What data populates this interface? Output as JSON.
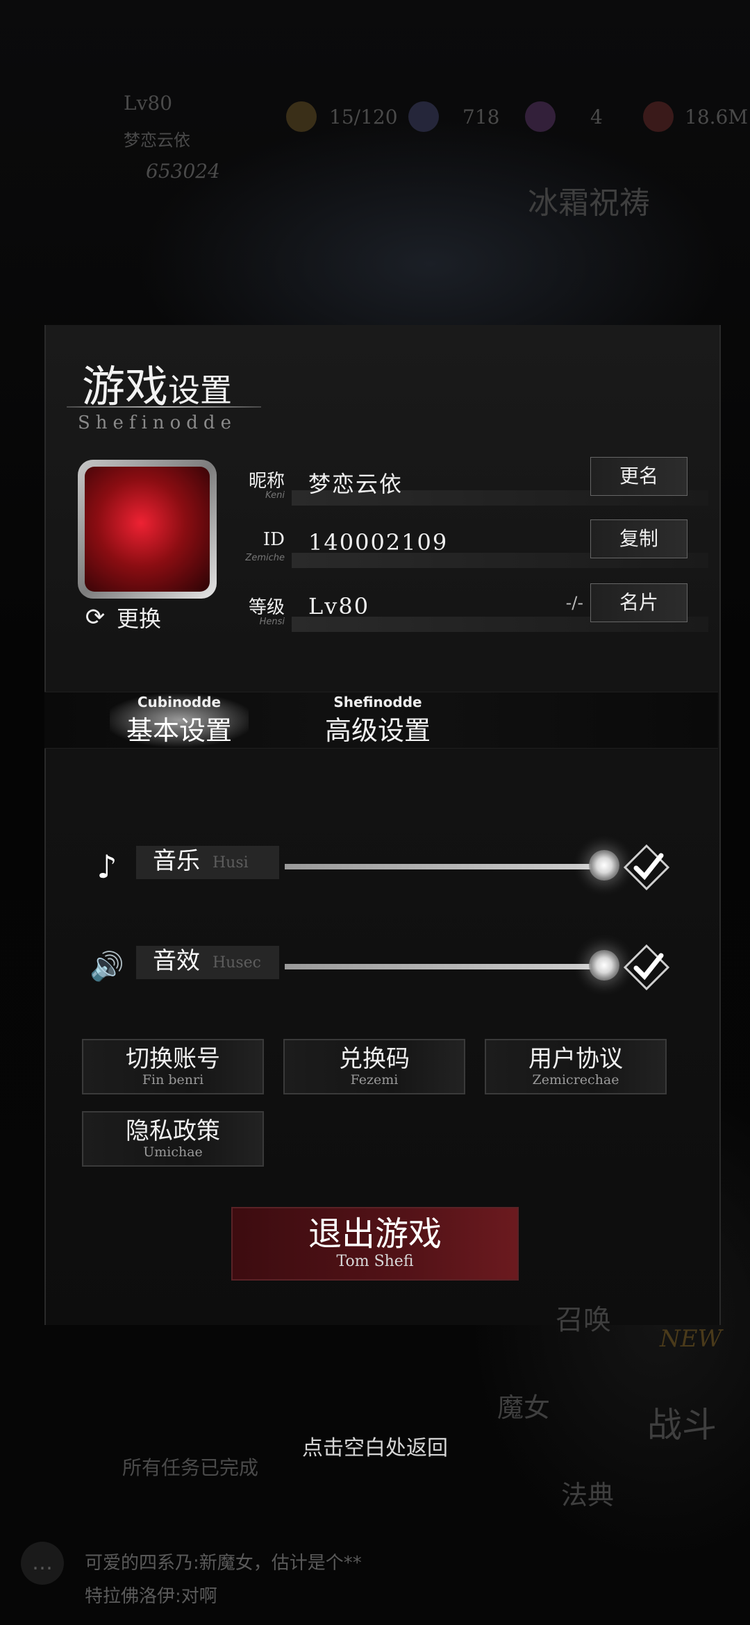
{
  "hud": {
    "level": "Lv80",
    "player_name": "梦恋云依",
    "power": "653024",
    "stamina": "15/120",
    "gems": "718",
    "shards": "4",
    "gold": "18.6M",
    "event_title": "冰霜祝祷"
  },
  "panel": {
    "title_big": "游戏",
    "title_small": "设置",
    "title_sub": "Shefinodde"
  },
  "profile": {
    "swap_label": "更换",
    "nickname_label": "昵称",
    "nickname_label_sub": "Keni",
    "nickname_value": "梦恋云依",
    "rename_button": "更名",
    "id_label": "ID",
    "id_label_sub": "Zemiche",
    "id_value": "140002109",
    "copy_button": "复制",
    "level_label": "等级",
    "level_label_sub": "Hensi",
    "level_value": "Lv80",
    "card_tag": "-/-",
    "card_button": "名片"
  },
  "tabs": [
    {
      "en": "Cubinodde",
      "zh": "基本设置",
      "active": true
    },
    {
      "en": "Shefinodde",
      "zh": "高级设置",
      "active": false
    }
  ],
  "audio": {
    "music_label": "音乐",
    "music_label_en": "Husi",
    "music_level": 1.0,
    "music_enabled": true,
    "sfx_label": "音效",
    "sfx_label_en": "Husec",
    "sfx_level": 1.0,
    "sfx_enabled": true
  },
  "buttons": {
    "switch_account": {
      "zh": "切换账号",
      "en": "Fin benri"
    },
    "redeem_code": {
      "zh": "兑换码",
      "en": "Fezemi"
    },
    "user_agreement": {
      "zh": "用户协议",
      "en": "Zemicrechae"
    },
    "privacy_policy": {
      "zh": "隐私政策",
      "en": "Umichae"
    },
    "exit_game": {
      "zh": "退出游戏",
      "en": "Tom Shefi"
    }
  },
  "dismiss_hint": "点击空白处返回",
  "bottom": {
    "mission_status": "所有任务已完成",
    "summon": "召唤",
    "witch": "魔女",
    "codex": "法典",
    "battle": "战斗",
    "new_badge": "NEW",
    "chat_line_1": "可爱的四系乃:新魔女，估计是个**",
    "chat_line_2": "特拉佛洛伊:对啊"
  },
  "colors": {
    "exit_button": "#521217",
    "panel_bg": "#141414",
    "text_primary": "#f0f0f0"
  }
}
